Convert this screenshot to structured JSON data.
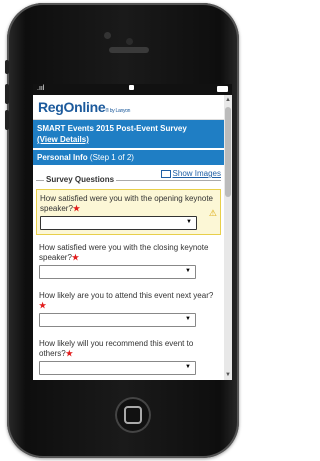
{
  "device": {
    "frame": "iPhone"
  },
  "statusbar": {
    "signal": ".ııl"
  },
  "app": {
    "logo": "RegOnline",
    "logo_suffix": "® by Lanyon"
  },
  "banner": {
    "title": "SMART Events 2015 Post-Event Survey",
    "view_details": "(View Details)"
  },
  "section_header": {
    "title": "Personal Info",
    "step": "(Step 1 of 2)"
  },
  "show_images": "Show Images",
  "survey": {
    "legend": "Survey Questions",
    "questions": [
      {
        "text": "How satisfied were you with the opening keynote speaker?",
        "required": "★",
        "highlighted": true
      },
      {
        "text": "How satisfied were you with the closing keynote speaker?",
        "required": "★",
        "highlighted": false
      },
      {
        "text": "How likely are you to attend this event next year?",
        "required": "★",
        "highlighted": false
      },
      {
        "text": "How likely will you recommend this event to others?",
        "required": "★",
        "highlighted": false
      }
    ]
  },
  "icons": {
    "warning": "warning-icon",
    "dropdown": "chevron-down-icon",
    "images": "image-icon"
  },
  "colors": {
    "brand_blue": "#1f7ec4",
    "logo_blue": "#1c5a9c",
    "required_red": "#e21c1c",
    "highlight_bg": "#fcf7d6"
  }
}
